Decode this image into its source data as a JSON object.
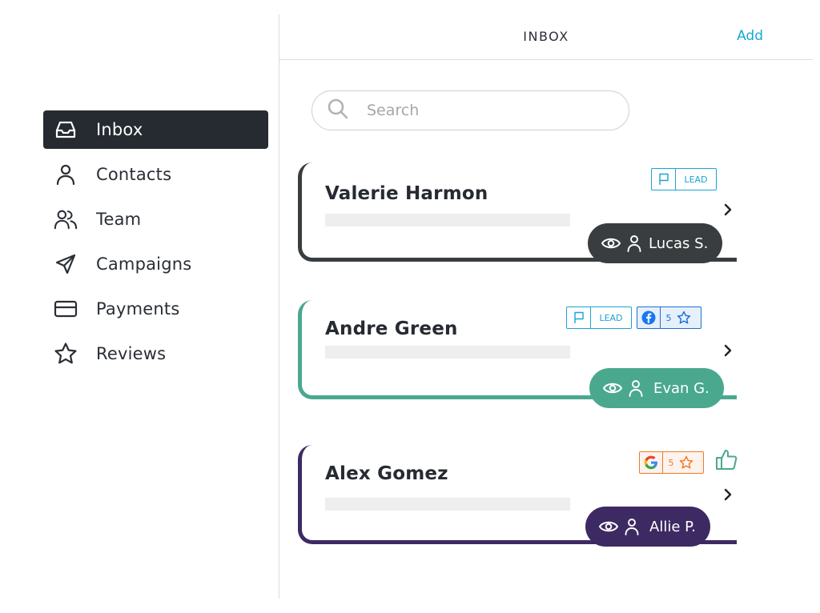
{
  "header": {
    "title": "INBOX",
    "add_label": "Add"
  },
  "sidebar": {
    "items": [
      {
        "label": "Inbox",
        "icon": "inbox-icon",
        "active": true
      },
      {
        "label": "Contacts",
        "icon": "user-icon"
      },
      {
        "label": "Team",
        "icon": "team-icon"
      },
      {
        "label": "Campaigns",
        "icon": "send-icon"
      },
      {
        "label": "Payments",
        "icon": "credit-card-icon"
      },
      {
        "label": "Reviews",
        "icon": "star-icon"
      }
    ]
  },
  "search": {
    "placeholder": "Search",
    "value": ""
  },
  "conversations": [
    {
      "name": "Valerie Harmon",
      "accent": "#3a3d3f",
      "assignee": "Lucas S.",
      "tags": [
        {
          "type": "lead",
          "label": "LEAD",
          "color": "#1aa3d4"
        }
      ]
    },
    {
      "name": "Andre Green",
      "accent": "#4aa88f",
      "assignee": "Evan G.",
      "tags": [
        {
          "type": "lead",
          "label": "LEAD",
          "color": "#1aa3d4"
        },
        {
          "type": "review",
          "source": "facebook",
          "rating": "5",
          "color": "#1f6fd6"
        }
      ]
    },
    {
      "name": "Alex Gomez",
      "accent": "#3d2a63",
      "assignee": "Allie P.",
      "liked": true,
      "tags": [
        {
          "type": "review",
          "source": "google",
          "rating": "5",
          "color": "#ee7a2b"
        }
      ]
    }
  ],
  "colors": {
    "brand": "#14a8d4",
    "active_nav": "#262a31",
    "like": "#4aa88f"
  }
}
